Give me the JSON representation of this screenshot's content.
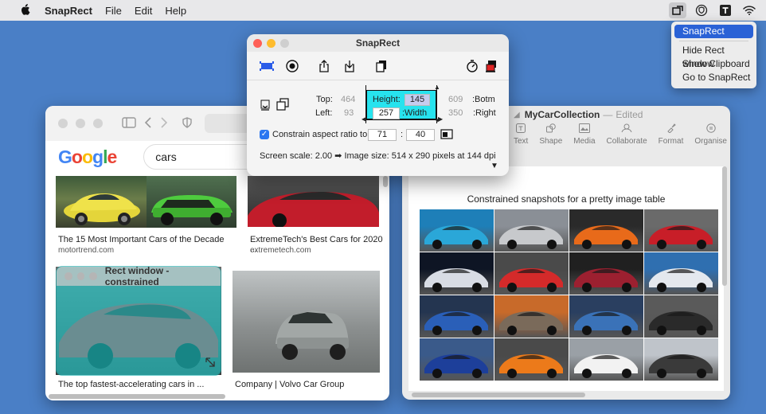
{
  "menubar": {
    "apple": "",
    "app_name": "SnapRect",
    "menus": [
      "File",
      "Edit",
      "Help"
    ]
  },
  "dropdown": {
    "items": [
      "SnapRect",
      "Hide Rect window",
      "Show Clipboard",
      "Go to SnapRect"
    ],
    "selected": "SnapRect"
  },
  "browser": {
    "search_query": "cars",
    "results": [
      {
        "caption": "The 15 Most Important Cars of the Decade",
        "source": "motortrend.com"
      },
      {
        "caption": "ExtremeTech's Best Cars for 2020 ...",
        "source": "extremetech.com"
      },
      {
        "caption": "The top fastest-accelerating cars in ...",
        "source": ""
      },
      {
        "caption": "Company | Volvo Car Group",
        "source": ""
      }
    ]
  },
  "rect_window": {
    "title": "Rect window - constrained"
  },
  "pages": {
    "doc_name": "MyCarCollection",
    "separator": "—",
    "status": "Edited",
    "tools": [
      "Text",
      "Shape",
      "Media",
      "Collaborate",
      "Format",
      "Organise"
    ],
    "heading": "Constrained snapshots for a pretty image table"
  },
  "snaprect": {
    "title": "SnapRect",
    "top_label": "Top:",
    "top_value": "464",
    "left_label": "Left:",
    "left_value": "93",
    "height_label": "Height:",
    "height_value": "145",
    "width_value": "257",
    "width_label": ":Width",
    "bottom_value": "609",
    "bottom_label": ":Botm",
    "right_value": "350",
    "right_label": ":Right",
    "constrain_label": "Constrain aspect ratio to:",
    "ratio_w": "71",
    "ratio_sep": ":",
    "ratio_h": "40",
    "screen_scale": "Screen scale: 2.00 ➡ Image size: 514 x 290 pixels at 144 dpi"
  },
  "colors": {
    "desktop": "#4a7fc6",
    "accent": "#2a62d6",
    "rect_cyan": "#27e3ee"
  }
}
